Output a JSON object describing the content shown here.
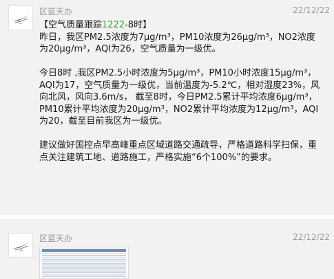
{
  "messages": [
    {
      "sender": "区蓝天办",
      "time": "22/12/22",
      "avatar": "blue-sky-office-logo",
      "header": {
        "open_bracket": "【空气质量跟踪",
        "number": "1222",
        "suffix": "-8时】"
      },
      "paragraphs": [
        "昨日，我区PM2.5浓度为7μg/m³，PM10浓度为26μg/m³，NO2浓度为20μg/m³，AQI为26，空气质量为一级优。",
        "今日8时 ,我区PM2.5小时浓度为5μg/m³，PM10小时浓度15μg/m³，AQI为17，空气质量为一级优，当前温度为-5.2℃，相对湿度23%，风向北风，风向3.6m/s，  截至8时，今日PM2.5累计平均浓度6μg/m³，PM10累计平均浓度为20μg/m³，NO2累计平均浓度为12μg/m³，AQI为20，截至目前我区为一级优。",
        "建议做好国控点早高峰重点区域道路交通疏导，严格道路科学扫保，重点关注建筑工地、道路施工，严格实施“6个100%”的要求。"
      ]
    },
    {
      "sender": "区蓝天办",
      "time": "22/12/22",
      "avatar": "blue-sky-office-logo",
      "attachment": "spreadsheet-thumbnail"
    }
  ],
  "colors": {
    "highlight": "#2da62d",
    "background": "#f2f2f2",
    "meta_text": "#9a9a9a"
  }
}
